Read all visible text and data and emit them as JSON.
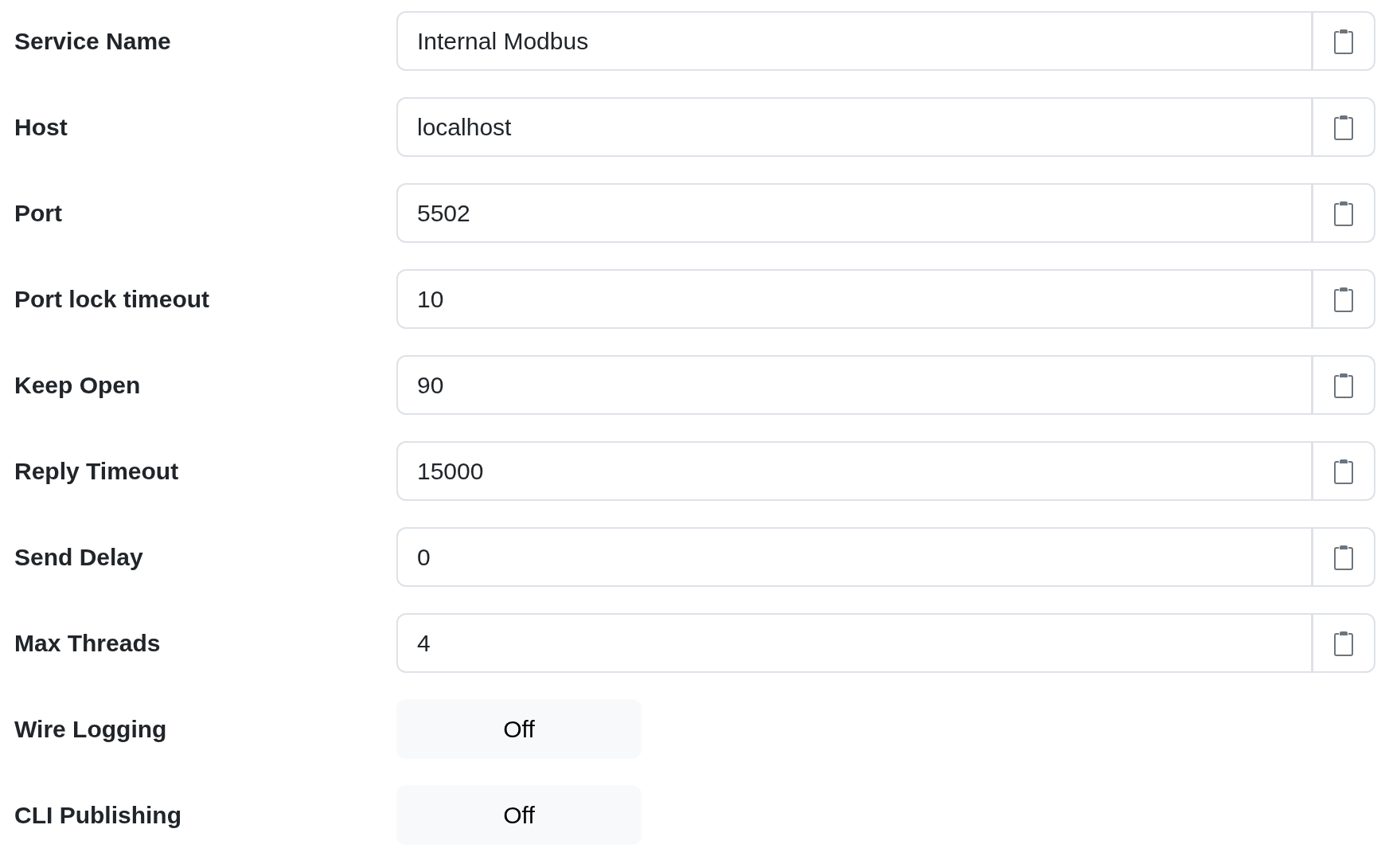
{
  "fields": [
    {
      "kind": "text",
      "label": "Service Name",
      "value": "Internal Modbus"
    },
    {
      "kind": "text",
      "label": "Host",
      "value": "localhost"
    },
    {
      "kind": "text",
      "label": "Port",
      "value": "5502"
    },
    {
      "kind": "text",
      "label": "Port lock timeout",
      "value": "10"
    },
    {
      "kind": "text",
      "label": "Keep Open",
      "value": "90"
    },
    {
      "kind": "text",
      "label": "Reply Timeout",
      "value": "15000"
    },
    {
      "kind": "text",
      "label": "Send Delay",
      "value": "0"
    },
    {
      "kind": "text",
      "label": "Max Threads",
      "value": "4"
    },
    {
      "kind": "toggle",
      "label": "Wire Logging",
      "on": false,
      "text": "Off"
    },
    {
      "kind": "toggle",
      "label": "CLI Publishing",
      "on": false,
      "text": "Off"
    }
  ]
}
